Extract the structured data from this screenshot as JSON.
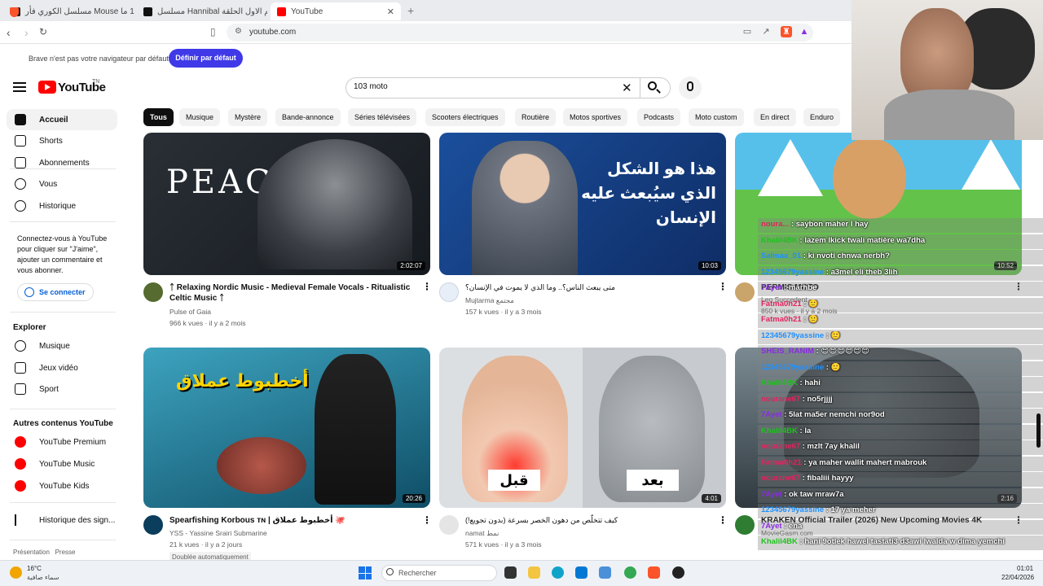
{
  "browser": {
    "tabs": [
      {
        "label": "مسلسل الكوري فأر Mouse الحلقة 1 ما",
        "active": false
      },
      {
        "label": "مسلسل Hannibal الموسم الاول الحلقة",
        "active": false
      },
      {
        "label": "YouTube",
        "active": true
      }
    ],
    "url": "youtube.com",
    "infobar_text": "Brave n'est pas votre navigateur par défaut",
    "infobar_button": "Définir par défaut"
  },
  "youtube": {
    "logo_text": "YouTube",
    "country_code": "TN",
    "search_value": "103 moto",
    "sidebar": {
      "main": [
        {
          "label": "Accueil",
          "icon": "home-icon",
          "active": true
        },
        {
          "label": "Shorts",
          "icon": "shorts-icon"
        },
        {
          "label": "Abonnements",
          "icon": "subscriptions-icon"
        }
      ],
      "you": [
        {
          "label": "Vous",
          "icon": "account-icon"
        },
        {
          "label": "Historique",
          "icon": "history-icon"
        }
      ],
      "signin_prompt": "Connectez-vous à YouTube pour cliquer sur \"J'aime\", ajouter un commentaire et vous abonner.",
      "signin_button": "Se connecter",
      "explore_heading": "Explorer",
      "explore": [
        {
          "label": "Musique",
          "icon": "music-icon"
        },
        {
          "label": "Jeux vidéo",
          "icon": "gaming-icon"
        },
        {
          "label": "Sport",
          "icon": "trophy-icon"
        }
      ],
      "more_heading": "Autres contenus YouTube",
      "more": [
        {
          "label": "YouTube Premium",
          "icon": "yt-premium-icon"
        },
        {
          "label": "YouTube Music",
          "icon": "yt-music-icon"
        },
        {
          "label": "YouTube Kids",
          "icon": "yt-kids-icon"
        }
      ],
      "report_history": "Historique des sign...",
      "footer": "Présentation   Presse"
    },
    "chips": [
      "Tous",
      "Musique",
      "Mystère",
      "Bande-annonce",
      "Séries télévisées",
      "Scooters électriques",
      "Routière",
      "Motos sportives",
      "Podcasts",
      "Moto custom",
      "En direct",
      "Enduro"
    ],
    "videos": [
      {
        "title": "ᛏ Relaxing Nordic Music - Medieval Female Vocals - Ritualistic Celtic Music ᛏ",
        "channel": "Pulse of Gaia",
        "meta": "966 k vues · il y a 2 mois",
        "duration": "2:02:07",
        "overlay_text": "PEACE",
        "colors": [
          "#2a2f36",
          "#151a1f"
        ]
      },
      {
        "title": "متى يبعث الناس؟.. وما الذي لا يموت في الإنسان؟",
        "channel": "Mujtarma مجتمع",
        "meta": "157 k vues · il y a 3 mois",
        "duration": "10:03",
        "overlay_text": "هذا هو الشكل الذي سيُبعث عليه الإنسان",
        "colors": [
          "#1b4f9c",
          "#0f2d66"
        ]
      },
      {
        "title": "PERMIS MOTO",
        "channel": "Leo Succedent",
        "meta": "850 k vues · il y a 2 mois",
        "duration": "10:52",
        "overlay_text": "",
        "colors": [
          "#56c0ea",
          "#63c24a"
        ]
      },
      {
        "title": "Spearfishing Korbous ᴛɴ | أخطبوط عملاق 🐙",
        "channel": "YSS - Yassine Srairi Submarine",
        "meta": "21 k vues · il y a 2 jours",
        "badge": "Doublée automatiquement",
        "duration": "20:26",
        "overlay_text": "أخطبوط عملاق",
        "colors": [
          "#2e7d9a",
          "#0f4e66"
        ]
      },
      {
        "title": "كيف تتخلّص من دهون الخصر بسرعة (بدون تجويع!)",
        "channel": "namat نمط",
        "meta": "571 k vues · il y a 3 mois",
        "duration": "4:01",
        "overlay_text_left": "قبل",
        "overlay_text_right": "بعد",
        "colors": [
          "#d9dde1",
          "#b9bec3"
        ]
      },
      {
        "title": "KRAKEN Official Trailer (2026) New Upcoming Movies 4K",
        "channel": "MovieGasm.com",
        "meta": "",
        "duration": "2:16",
        "overlay_text": "",
        "colors": [
          "#5b6a72",
          "#2f393f"
        ]
      }
    ]
  },
  "chat": [
    {
      "user": "noura...",
      "msg": "saybon maher l hay",
      "color": "#e0245e"
    },
    {
      "user": "Khalil4BK",
      "msg": "lazem lkick twali matière wa7dha",
      "color": "#1fc11f"
    },
    {
      "user": "Salmaa_01",
      "msg": "ki nvoti chnwa nerbh?",
      "color": "#1e90ff"
    },
    {
      "user": "12345679yassine",
      "msg": "a3mel eli theb 3lih",
      "color": "#1e90ff"
    },
    {
      "user": "7Ayet",
      "msg": "marhbe",
      "color": "#8a2be2"
    },
    {
      "user": "Fatma0h21",
      "msg": "🙂",
      "color": "#e0245e"
    },
    {
      "user": "Fatma0h21",
      "msg": "🙂",
      "color": "#e0245e"
    },
    {
      "user": "12345679yassine",
      "msg": "🙂",
      "color": "#1e90ff"
    },
    {
      "user": "SHEIS_RANIM",
      "msg": "😍😍😍😍😍😍",
      "color": "#8a2be2"
    },
    {
      "user": "12345679yassine",
      "msg": "🙂",
      "color": "#1e90ff"
    },
    {
      "user": "Khalil4BK",
      "msg": "hahi",
      "color": "#1fc11f"
    },
    {
      "user": "nourane67",
      "msg": "no5rjjjj",
      "color": "#e0245e"
    },
    {
      "user": "7Ayet",
      "msg": "5lat ma5er nemchi nor9od",
      "color": "#8a2be2"
    },
    {
      "user": "Khalil4BK",
      "msg": "la",
      "color": "#1fc11f"
    },
    {
      "user": "nourane67",
      "msg": "mzlt 7ay khalil",
      "color": "#e0245e"
    },
    {
      "user": "Fatma0h21",
      "msg": "ya maher wallit mahert mabrouk",
      "color": "#e0245e"
    },
    {
      "user": "nourane67",
      "msg": "fibaliii hayyy",
      "color": "#e0245e"
    },
    {
      "user": "7Ayet",
      "msg": "ok taw mraw7a",
      "color": "#8a2be2"
    },
    {
      "user": "12345679yassine",
      "msg": "17 ya meher",
      "color": "#1e90ff"
    },
    {
      "user": "7Ayet",
      "msg": "ena",
      "color": "#8a2be2"
    },
    {
      "user": "Khalil4BK",
      "msg": "hani 9otlek hawel tastati3 d3awi lwalda w dima yemchi",
      "color": "#1fc11f"
    }
  ],
  "taskbar": {
    "weather_temp": "16°C",
    "weather_desc": "سماء صافية",
    "search_label": "Rechercher",
    "time": "01:01",
    "date": "22/04/2026"
  }
}
